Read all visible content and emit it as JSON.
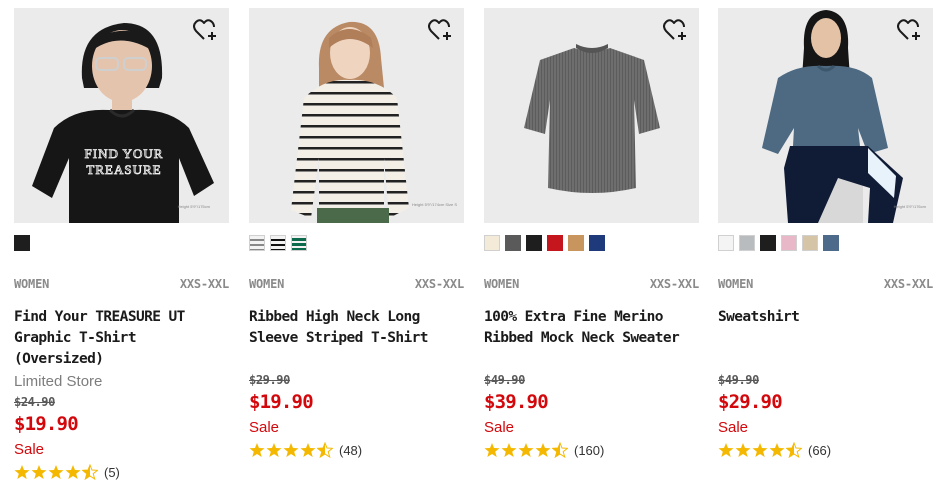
{
  "products": [
    {
      "category": "WOMEN",
      "size_range": "XXS-XXL",
      "name_line1": "Find Your TREASURE UT",
      "name_line2": "Graphic T-Shirt (Oversized)",
      "store": "Limited Store",
      "original_price": "$24.90",
      "price": "$19.90",
      "sale": "Sale",
      "rating_value": 4.5,
      "review_count": "(5)",
      "swatches": [
        "#1e1e1e"
      ],
      "image_caption": "Height 5'9\"/175cm"
    },
    {
      "category": "WOMEN",
      "size_range": "XXS-XXL",
      "name_line1": "Ribbed High Neck Long",
      "name_line2": "Sleeve Striped T-Shirt",
      "store": "",
      "original_price": "$29.90",
      "price": "$19.90",
      "sale": "Sale",
      "rating_value": 4.5,
      "review_count": "(48)",
      "swatches": [
        "stripe-gray",
        "stripe-black",
        "stripe-green"
      ],
      "image_caption": "Height 5'9\"/174cm Size S"
    },
    {
      "category": "WOMEN",
      "size_range": "XXS-XXL",
      "name_line1": "100% Extra Fine Merino",
      "name_line2": "Ribbed Mock Neck Sweater",
      "store": "",
      "original_price": "$49.90",
      "price": "$39.90",
      "sale": "Sale",
      "rating_value": 4.5,
      "review_count": "(160)",
      "swatches": [
        "#f3ead8",
        "#5a5a5a",
        "#1e1e1e",
        "#c4161c",
        "#c9955e",
        "#1f3a7a"
      ]
    },
    {
      "category": "WOMEN",
      "size_range": "XXS-XXL",
      "name_line1": "Sweatshirt",
      "name_line2": "",
      "store": "",
      "original_price": "$49.90",
      "price": "$29.90",
      "sale": "Sale",
      "rating_value": 4.5,
      "review_count": "(66)",
      "swatches": [
        "#f4f4f4",
        "#b9bcbf",
        "#1e1e1e",
        "#e8b8c8",
        "#d6c4a6",
        "#4d6a8a"
      ],
      "image_caption": "Height 5'9\"/176cm"
    }
  ],
  "icons": {
    "favorite": "heart-plus-icon",
    "star_full": "star-full-icon",
    "star_half": "star-half-icon"
  },
  "colors": {
    "sale_red": "#d3080c",
    "star_gold": "#f5b800",
    "muted_gray": "#8a8a8a"
  }
}
